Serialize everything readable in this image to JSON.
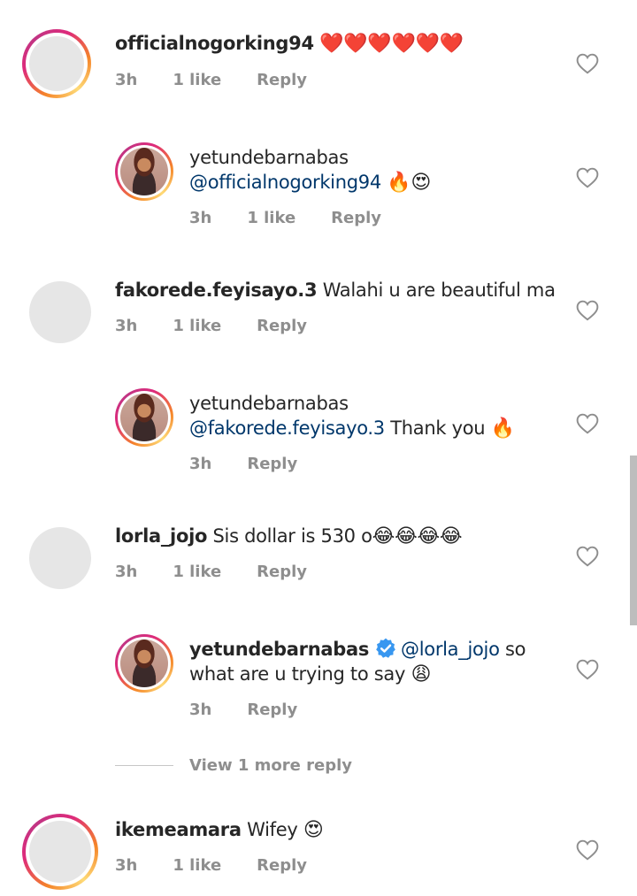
{
  "comments": [
    {
      "username": "officialnogorking94",
      "text": "",
      "emojis": "❤️❤️❤️❤️❤️❤️",
      "time": "3h",
      "likes": "1 like",
      "reply_label": "Reply",
      "avatar": "story-ring-blank"
    },
    {
      "username": "yetundebarnabas",
      "mention": "@officialnogorking94",
      "text": "",
      "emojis": "🔥😍",
      "time": "3h",
      "likes": "1 like",
      "reply_label": "Reply",
      "avatar": "story-ring-photo"
    },
    {
      "username": "fakorede.feyisayo.3",
      "text": "Walahi u are beautiful ma",
      "time": "3h",
      "likes": "1 like",
      "reply_label": "Reply",
      "avatar": "blank"
    },
    {
      "username": "yetundebarnabas",
      "mention": "@fakorede.feyisayo.3",
      "text": "Thank you",
      "emojis": "🔥",
      "time": "3h",
      "reply_label": "Reply",
      "avatar": "story-ring-photo"
    },
    {
      "username": "lorla_jojo",
      "text": "Sis dollar is 530 o",
      "emojis": "😂😂😂😂",
      "time": "3h",
      "likes": "1 like",
      "reply_label": "Reply",
      "avatar": "blank"
    },
    {
      "username": "yetundebarnabas",
      "verified": true,
      "mention": "@lorla_jojo",
      "text_line1": "so",
      "text_line2": "what are u trying to say",
      "emojis": "😩",
      "time": "3h",
      "reply_label": "Reply",
      "avatar": "story-ring-photo"
    },
    {
      "username": "ikemeamara",
      "text": "Wifey",
      "emojis": "😍",
      "time": "3h",
      "likes": "1 like",
      "reply_label": "Reply",
      "avatar": "story-ring-blank"
    }
  ],
  "view_more": "View 1 more reply",
  "icons": {
    "like": "heart-outline-icon",
    "verified": "verified-badge-icon"
  },
  "colors": {
    "mention": "#00376b",
    "meta": "#8e8e8e",
    "verified": "#3897f0"
  }
}
